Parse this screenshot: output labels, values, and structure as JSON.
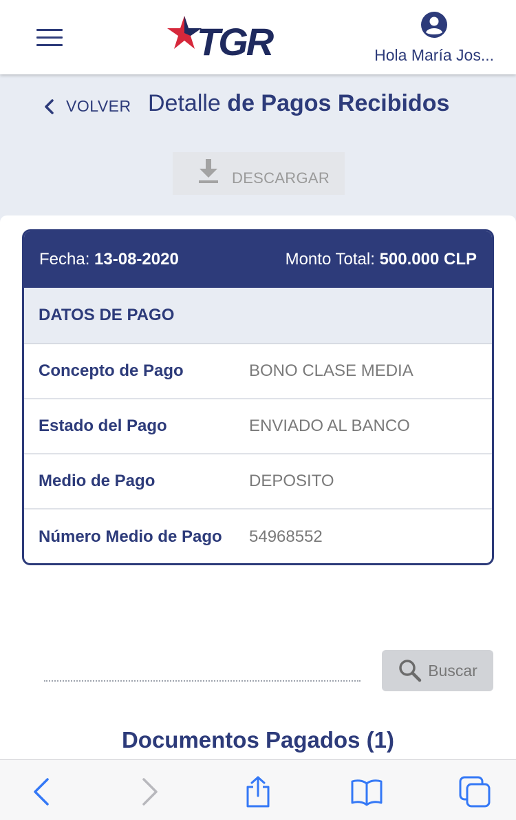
{
  "header": {
    "logo_text": "TGR",
    "user_greeting": "Hola María Jos...",
    "brand_color": "#2d3b7a",
    "star_color": "#d6283b"
  },
  "nav": {
    "back_label": "VOLVER",
    "title_light": "Detalle",
    "title_bold": "de Pagos Recibidos"
  },
  "download": {
    "label": "DESCARGAR",
    "icon": "download-icon"
  },
  "card": {
    "fecha_label": "Fecha:",
    "fecha_value": "13-08-2020",
    "monto_label": "Monto Total:",
    "monto_value": "500.000 CLP",
    "section_title": "DATOS DE PAGO",
    "rows": [
      {
        "label": "Concepto de Pago",
        "value": "BONO CLASE MEDIA"
      },
      {
        "label": "Estado del Pago",
        "value": "ENVIADO AL BANCO"
      },
      {
        "label": "Medio de Pago",
        "value": "DEPOSITO"
      },
      {
        "label": "Número Medio de Pago",
        "value": "54968552"
      }
    ]
  },
  "search": {
    "button_label": "Buscar",
    "icon": "search-icon"
  },
  "documents": {
    "title": "Documentos Pagados (1)"
  },
  "browser_toolbar": {
    "icons": [
      "back-arrow-icon",
      "forward-arrow-icon",
      "share-icon",
      "bookmarks-icon",
      "tabs-icon"
    ],
    "active_color": "#3478f6",
    "disabled_color": "#b8b8bd"
  }
}
